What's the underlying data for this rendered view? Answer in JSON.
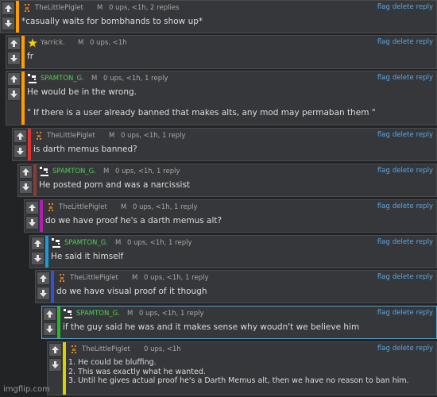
{
  "colors": {
    "bar1": "#ff9c00",
    "bar2": "#ff9c00",
    "bar3": "#ff9c00",
    "bar4": "#e03030",
    "bar5": "#8a3c32",
    "bar6": "#b020b0",
    "bar7": "#1a9ad6",
    "bar8": "#3050e0",
    "bar9": "#28b828",
    "bar10": "#d8d000"
  },
  "actions": {
    "flag": "flag",
    "delete": "delete",
    "reply": "reply"
  },
  "comments": [
    {
      "user": "TheLittlePiglet",
      "rank": "M",
      "meta": "0 ups, <1h, 2 replies",
      "text": "*casually waits for bombhands to show up*"
    },
    {
      "user": "Yarrick.",
      "rank": "M",
      "meta": "0 ups, <1h",
      "text": "fr"
    },
    {
      "user": "SPAMTON_G.",
      "rank": "M",
      "meta": "0 ups, <1h, 1 reply",
      "text": "He would be in the wrong.\n\n\" If there is a user already banned that makes alts, any mod may permaban them \""
    },
    {
      "user": "TheLittlePiglet",
      "rank": "M",
      "meta": "0 ups, <1h, 1 reply",
      "text": "is darth memus banned?"
    },
    {
      "user": "SPAMTON_G.",
      "rank": "M",
      "meta": "0 ups, <1h, 1 reply",
      "text": "He posted porn and was a narcissist"
    },
    {
      "user": "TheLittlePiglet",
      "rank": "M",
      "meta": "0 ups, <1h, 1 reply",
      "text": "do we have proof he's a darth memus alt?"
    },
    {
      "user": "SPAMTON_G.",
      "rank": "M",
      "meta": "0 ups, <1h, 1 reply",
      "text": "He said it himself"
    },
    {
      "user": "TheLittlePiglet",
      "rank": "M",
      "meta": "0 ups, <1h, 1 reply",
      "text": "do we have visual proof of it though"
    },
    {
      "user": "SPAMTON_G.",
      "rank": "M",
      "meta": "0 ups, <1h, 1 reply",
      "text": "if the guy said he was and it makes sense why woudn't we believe him"
    },
    {
      "user": "TheLittlePiglet",
      "rank": "",
      "meta": "0 ups, <1h",
      "text": "1. He could be bluffing.\n2. This was exactly what he wanted.\n3. Until he gives actual proof he's a Darth Memus alt, then we have no reason to ban him."
    }
  ],
  "watermark": "imgflip.com"
}
